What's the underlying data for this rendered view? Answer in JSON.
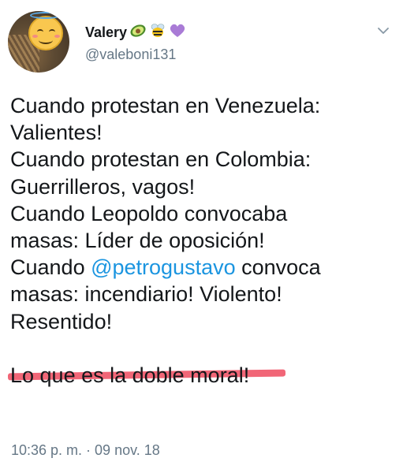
{
  "tweet": {
    "display_name": "Valery",
    "handle": "@valeboni131",
    "emojis": [
      "avocado-emoji",
      "bee-emoji",
      "purple-heart-emoji"
    ],
    "text_lines": {
      "l1": "Cuando protestan en Venezuela:",
      "l2": "Valientes!",
      "l3": "Cuando protestan en Colombia:",
      "l4": "Guerrilleros, vagos!",
      "l5": "Cuando Leopoldo convocaba",
      "l6": "masas:  Líder de oposición!",
      "l7_before": "Cuando ",
      "l7_mention": "@petrogustavo",
      "l7_after": " convoca",
      "l8": "masas: incendiario! Violento!",
      "l9": "Resentido!",
      "l11": "Lo que es la doble moral!"
    },
    "timestamp": "10:36 p. m. · 09 nov. 18",
    "colors": {
      "mention": "#1b95e0",
      "marker": "#ef4b5f",
      "secondary_text": "#657786"
    }
  }
}
